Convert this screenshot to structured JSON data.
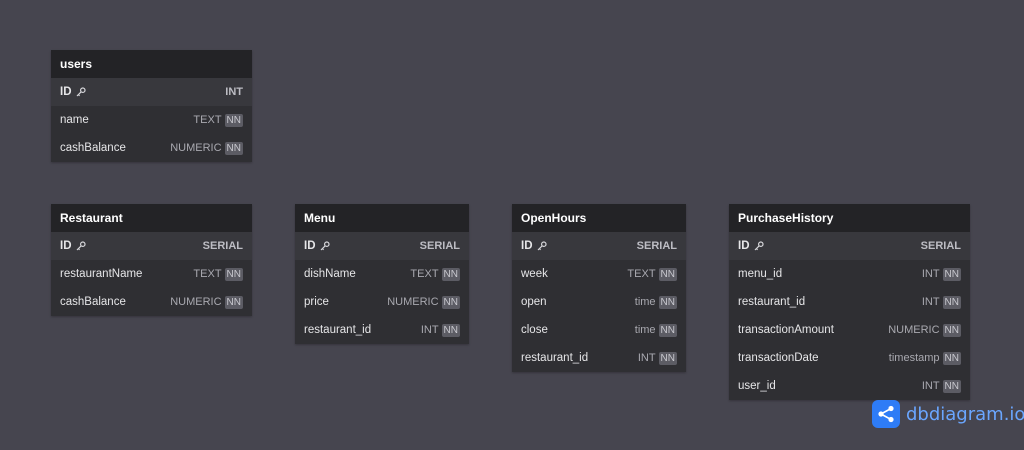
{
  "tables": [
    {
      "name": "users",
      "columns": [
        {
          "name": "ID",
          "type": "INT",
          "pk": true,
          "nn": false
        },
        {
          "name": "name",
          "type": "TEXT",
          "pk": false,
          "nn": true
        },
        {
          "name": "cashBalance",
          "type": "NUMERIC",
          "pk": false,
          "nn": true
        }
      ]
    },
    {
      "name": "Restaurant",
      "columns": [
        {
          "name": "ID",
          "type": "SERIAL",
          "pk": true,
          "nn": false
        },
        {
          "name": "restaurantName",
          "type": "TEXT",
          "pk": false,
          "nn": true
        },
        {
          "name": "cashBalance",
          "type": "NUMERIC",
          "pk": false,
          "nn": true
        }
      ]
    },
    {
      "name": "Menu",
      "columns": [
        {
          "name": "ID",
          "type": "SERIAL",
          "pk": true,
          "nn": false
        },
        {
          "name": "dishName",
          "type": "TEXT",
          "pk": false,
          "nn": true
        },
        {
          "name": "price",
          "type": "NUMERIC",
          "pk": false,
          "nn": true
        },
        {
          "name": "restaurant_id",
          "type": "INT",
          "pk": false,
          "nn": true
        }
      ]
    },
    {
      "name": "OpenHours",
      "columns": [
        {
          "name": "ID",
          "type": "SERIAL",
          "pk": true,
          "nn": false
        },
        {
          "name": "week",
          "type": "TEXT",
          "pk": false,
          "nn": true
        },
        {
          "name": "open",
          "type": "time",
          "pk": false,
          "nn": true
        },
        {
          "name": "close",
          "type": "time",
          "pk": false,
          "nn": true
        },
        {
          "name": "restaurant_id",
          "type": "INT",
          "pk": false,
          "nn": true
        }
      ]
    },
    {
      "name": "PurchaseHistory",
      "columns": [
        {
          "name": "ID",
          "type": "SERIAL",
          "pk": true,
          "nn": false
        },
        {
          "name": "menu_id",
          "type": "INT",
          "pk": false,
          "nn": true
        },
        {
          "name": "restaurant_id",
          "type": "INT",
          "pk": false,
          "nn": true
        },
        {
          "name": "transactionAmount",
          "type": "NUMERIC",
          "pk": false,
          "nn": true
        },
        {
          "name": "transactionDate",
          "type": "timestamp",
          "pk": false,
          "nn": true
        },
        {
          "name": "user_id",
          "type": "INT",
          "pk": false,
          "nn": true
        }
      ]
    }
  ],
  "nn_label": "NN",
  "brand": {
    "text": "dbdiagram.io",
    "icon": "share-nodes-icon",
    "color": "#2e7cf6"
  }
}
